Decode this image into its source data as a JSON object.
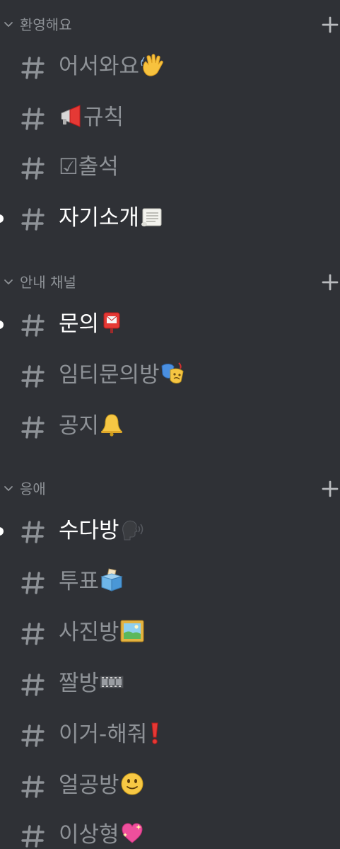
{
  "categories": [
    {
      "name": "환영해요",
      "channels": [
        {
          "name": "어서와요",
          "emoji": "waving-hand-icon",
          "unread": false
        },
        {
          "name": "규칙",
          "emoji": "megaphone-icon",
          "emoji_position": "before",
          "unread": false
        },
        {
          "name": "☑출석",
          "emoji": "",
          "unread": false
        },
        {
          "name": "자기소개",
          "emoji": "scroll-icon",
          "unread": true
        }
      ]
    },
    {
      "name": "안내 채널",
      "channels": [
        {
          "name": "문의",
          "emoji": "postbox-icon",
          "unread": true
        },
        {
          "name": "임티문의방",
          "emoji": "theater-masks-icon",
          "unread": false
        },
        {
          "name": "공지",
          "emoji": "bell-icon",
          "unread": false
        }
      ]
    },
    {
      "name": "응애",
      "channels": [
        {
          "name": "수다방",
          "emoji": "speaking-head-icon",
          "unread": true
        },
        {
          "name": "투표",
          "emoji": "ballot-box-icon",
          "unread": false
        },
        {
          "name": "사진방",
          "emoji": "framed-picture-icon",
          "unread": false
        },
        {
          "name": "짤방",
          "emoji": "film-frames-icon",
          "unread": false
        },
        {
          "name": "이거-해줘",
          "emoji": "exclamation-icon",
          "unread": false
        },
        {
          "name": "얼공방",
          "emoji": "slight-smile-icon",
          "unread": false
        },
        {
          "name": "이상형",
          "emoji": "sparkling-heart-icon",
          "unread": false
        }
      ]
    }
  ],
  "colors": {
    "background": "#2f3136",
    "muted_text": "#8e9297",
    "unread_text": "#ffffff",
    "unread_dot": "#ffffff"
  }
}
